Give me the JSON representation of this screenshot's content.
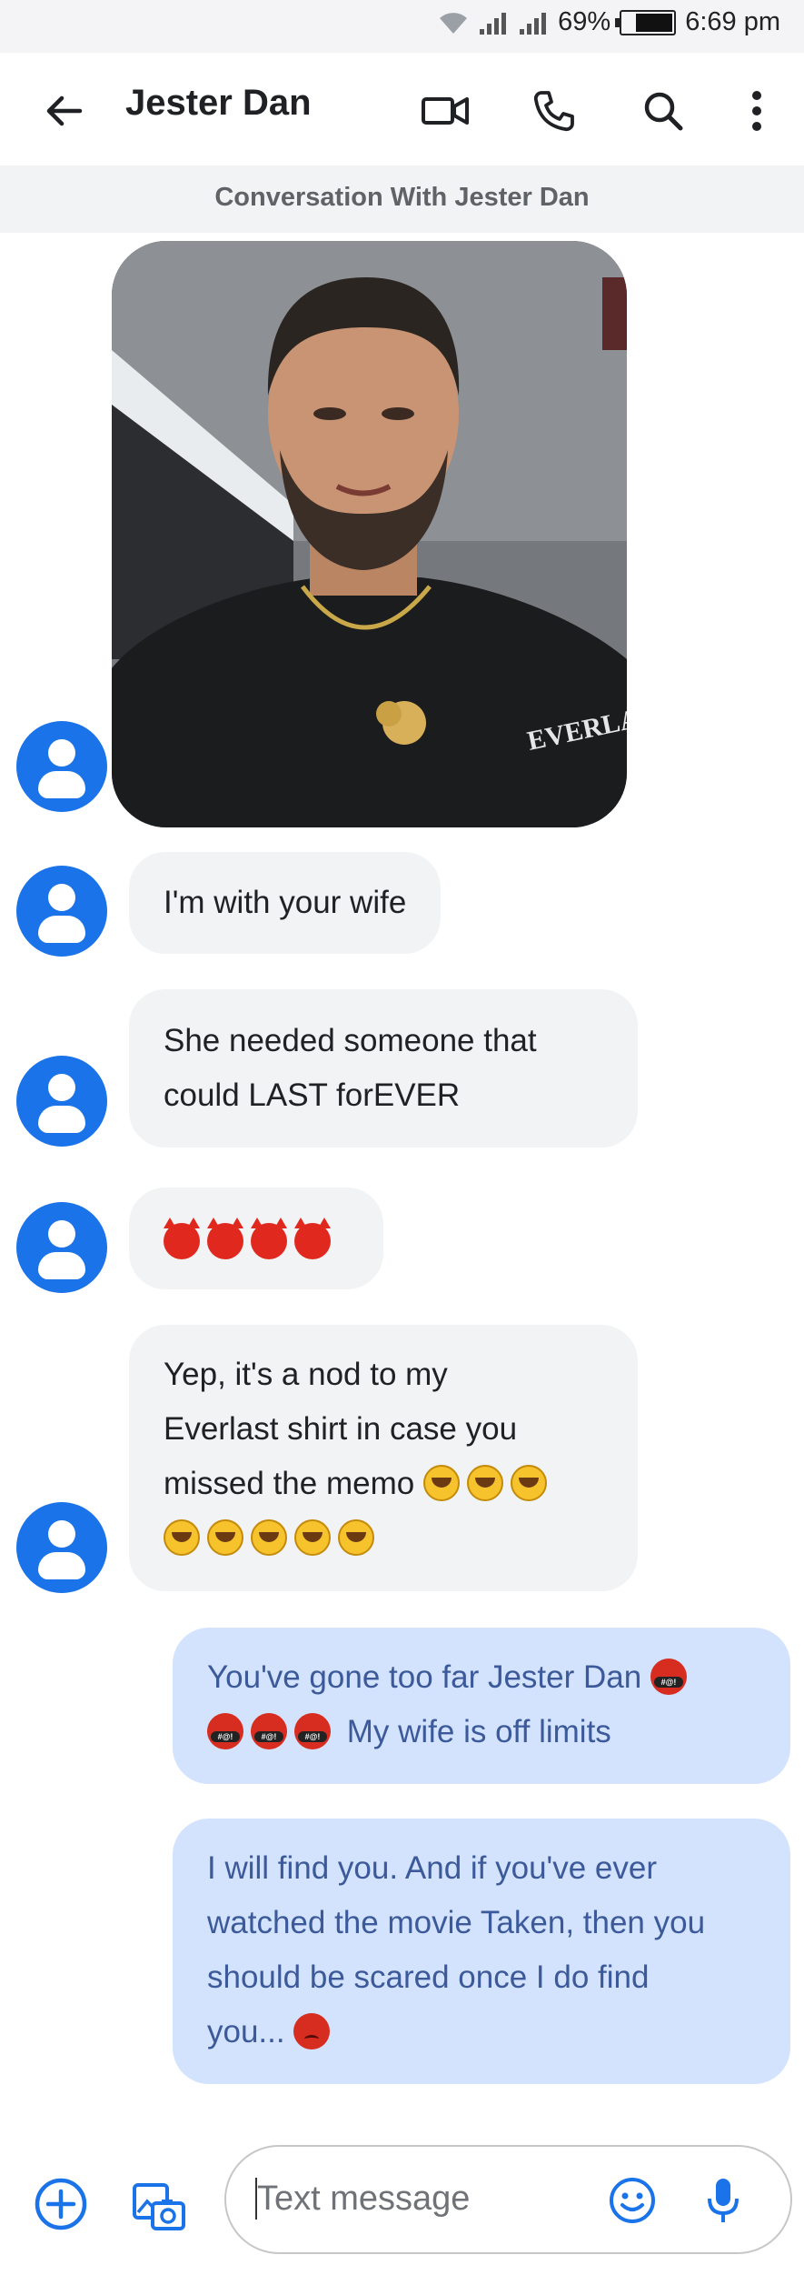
{
  "status_bar": {
    "battery": "69%",
    "time": "6:69 pm"
  },
  "app_bar": {
    "title": "Jester Dan",
    "icons": [
      "back-arrow-icon",
      "video-call-icon",
      "phone-icon",
      "search-icon",
      "more-vert-icon"
    ]
  },
  "conversation_label": "Conversation With Jester Dan",
  "messages": [
    {
      "direction": "incoming",
      "type": "image",
      "description_icon": "photo"
    },
    {
      "direction": "incoming",
      "type": "text",
      "text": "I'm with your wife"
    },
    {
      "direction": "incoming",
      "type": "text",
      "lines": [
        "She needed someone that",
        "could LAST forEVER"
      ]
    },
    {
      "direction": "incoming",
      "type": "emoji",
      "emoji": [
        "smiling-imp",
        "smiling-imp",
        "smiling-imp",
        "smiling-imp"
      ]
    },
    {
      "direction": "incoming",
      "type": "text",
      "lines": [
        "Yep, it's a nod to my",
        "Everlast shirt in case you",
        "missed the memo"
      ],
      "emoji": [
        "rofl",
        "rofl",
        "rofl",
        "rofl",
        "rofl",
        "rofl",
        "rofl",
        "rofl"
      ]
    },
    {
      "direction": "outgoing",
      "type": "text",
      "lines": [
        "You've gone too far Jester Dan",
        "My wife is off limits"
      ],
      "emoji": [
        "cursing-face",
        "cursing-face",
        "cursing-face",
        "cursing-face"
      ]
    },
    {
      "direction": "outgoing",
      "type": "text",
      "lines": [
        "I will find you. And if you've ever",
        "watched the movie Taken, then you",
        "should be scared once I do find",
        "you..."
      ],
      "emoji": [
        "angry-face"
      ]
    }
  ],
  "composer": {
    "placeholder": "Text message",
    "icons": [
      "add-icon",
      "gallery-icon",
      "emoji-icon",
      "mic-icon"
    ]
  },
  "colors": {
    "accent": "#1a73e8",
    "incoming_bubble": "#f1f3f4",
    "outgoing_bubble": "#d3e3fd",
    "outgoing_text": "#3c5a9a"
  }
}
